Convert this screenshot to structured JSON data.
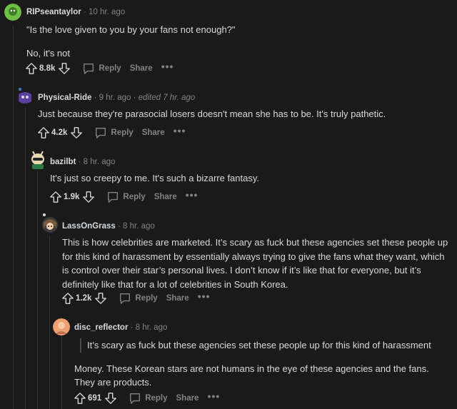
{
  "comments": [
    {
      "author": "RIPseantaylor",
      "time": "10 hr. ago",
      "edited": "",
      "paragraphs": [
        "\"Is the love given to you by your fans not enough?\"",
        "No, it's not"
      ],
      "votes": "8.8k",
      "avatar_color": "#6fbe45"
    },
    {
      "author": "Physical-Ride",
      "time": "9 hr. ago",
      "edited": "edited 7 hr. ago",
      "paragraphs": [
        "Just because they're parasocial losers doesn't mean she has to be. It's truly pathetic."
      ],
      "votes": "4.2k",
      "avatar_color": "#5a3fa0"
    },
    {
      "author": "bazilbt",
      "time": "8 hr. ago",
      "edited": "",
      "paragraphs": [
        "It's just so creepy to me. It's such a bizarre fantasy."
      ],
      "votes": "1.9k",
      "avatar_color": "#e8d8b0"
    },
    {
      "author": "LassOnGrass",
      "time": "8 hr. ago",
      "edited": "",
      "paragraphs": [
        "This is how celebrities are marketed. It’s scary as fuck but these agencies set these people up for this kind of harassment by essentially always trying to give the fans what they want, which is control over their star’s personal lives. I don’t know if it’s like that for everyone, but it’s definitely like that for a lot of celebrities in South Korea."
      ],
      "votes": "1.2k",
      "avatar_color": "#7a5a3a"
    },
    {
      "author": "disc_reflector",
      "time": "8 hr. ago",
      "edited": "",
      "quote": "It’s scary as fuck but these agencies set these people up for this kind of harassment",
      "paragraphs": [
        "Money. These Korean stars are not humans in the eye of these agencies and the fans. They are products."
      ],
      "votes": "691",
      "avatar_color": "#f0a070"
    }
  ],
  "labels": {
    "reply": "Reply",
    "share": "Share",
    "more": "•••",
    "separator": "·"
  },
  "colors": {
    "background": "#1a1a1b",
    "text": "#d7dadc",
    "muted": "#818384",
    "thread_line": "#343536"
  }
}
